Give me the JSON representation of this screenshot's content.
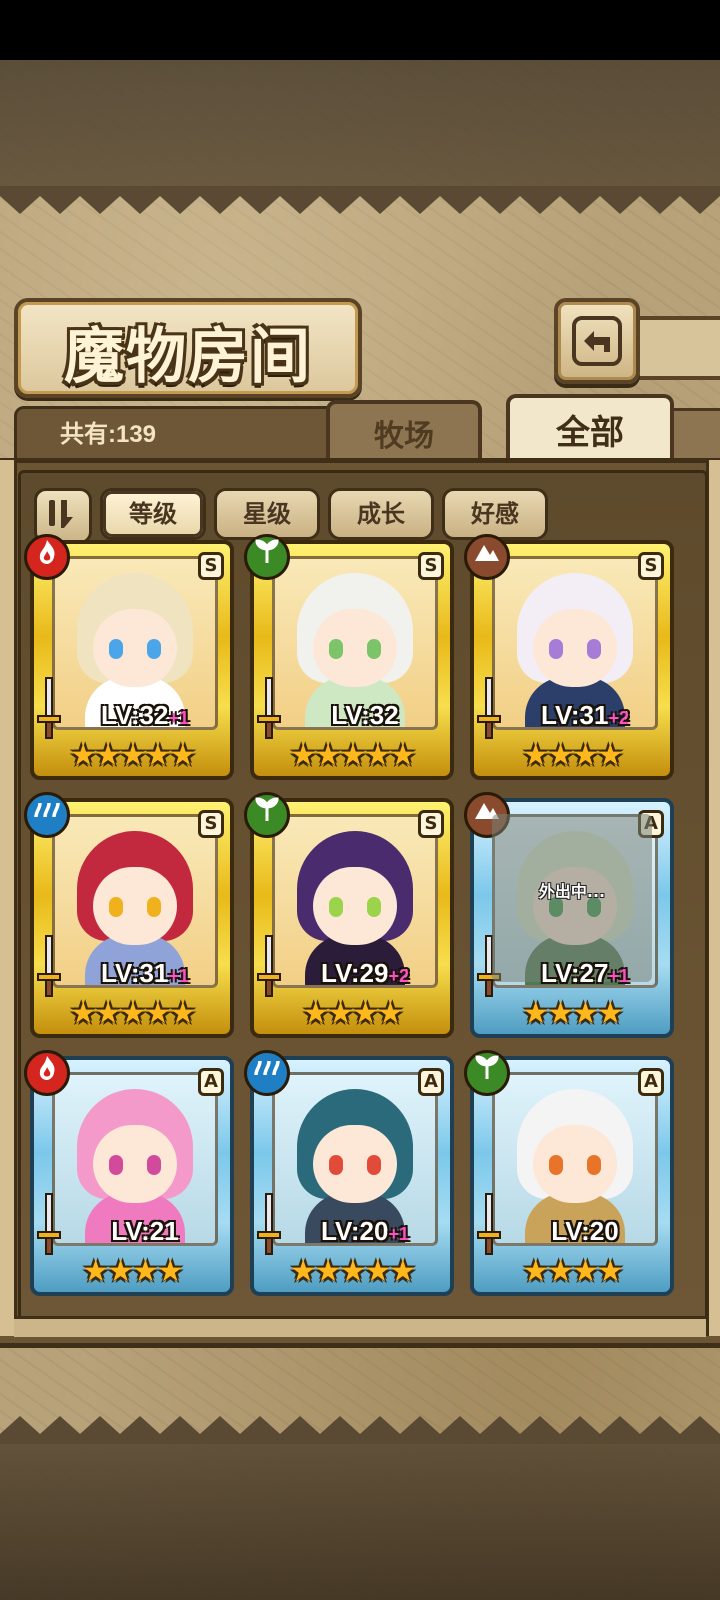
{
  "header": {
    "title": "魔物房间"
  },
  "tabs": {
    "count_label": "共有:139",
    "ranch": "牧场",
    "all": "全部"
  },
  "sort": {
    "buttons": [
      "等级",
      "星级",
      "成长",
      "好感"
    ],
    "active": "等级"
  },
  "cards": [
    {
      "element": "fire",
      "rank": "S",
      "frame": "gold",
      "level": "LV:32",
      "bonus": "+1",
      "stars": "★★★★★",
      "hair": "#efe3c0",
      "eye": "#4aa6e8",
      "outfit": "#ffffff"
    },
    {
      "element": "leaf",
      "rank": "S",
      "frame": "gold",
      "level": "LV:32",
      "bonus": "",
      "stars": "★★★★★",
      "hair": "#f1f1ee",
      "eye": "#7cc46a",
      "outfit": "#cfe8c4"
    },
    {
      "element": "earth",
      "rank": "S",
      "frame": "gold",
      "level": "LV:31",
      "bonus": "+2",
      "stars": "★★★★",
      "hair": "#f3eef6",
      "eye": "#a57cd6",
      "outfit": "#2c3f6a"
    },
    {
      "element": "water",
      "rank": "S",
      "frame": "gold",
      "level": "LV:31",
      "bonus": "+1",
      "stars": "★★★★★",
      "hair": "#c2283e",
      "eye": "#f0b21c",
      "outfit": "#8fa3d8"
    },
    {
      "element": "leaf",
      "rank": "S",
      "frame": "gold",
      "level": "LV:29",
      "bonus": "+2",
      "stars": "★★★★",
      "hair": "#4a2c6e",
      "eye": "#9bd34a",
      "outfit": "#2b1c3a"
    },
    {
      "element": "earth",
      "rank": "A",
      "frame": "blue",
      "level": "LV:27",
      "bonus": "+1",
      "stars": "★★★★",
      "hair": "#d8e6cc",
      "eye": "#3a9a4a",
      "outfit": "#4c7a52",
      "status": "外出中..."
    },
    {
      "element": "fire",
      "rank": "A",
      "frame": "blue",
      "level": "LV:21",
      "bonus": "",
      "stars": "★★★★",
      "hair": "#f49acb",
      "eye": "#d24a9c",
      "outfit": "#f07ac0"
    },
    {
      "element": "water",
      "rank": "A",
      "frame": "blue",
      "level": "LV:20",
      "bonus": "+1",
      "stars": "★★★★★",
      "hair": "#2a6a7a",
      "eye": "#e24a3a",
      "outfit": "#3a4a5e"
    },
    {
      "element": "leaf",
      "rank": "A",
      "frame": "blue",
      "level": "LV:20",
      "bonus": "",
      "stars": "★★★★",
      "hair": "#f4f4f4",
      "eye": "#e8742a",
      "outfit": "#c9a35a"
    }
  ],
  "colors": {
    "panel": "#6b5533",
    "gold_frame": "#e8b919",
    "blue_frame": "#7cc8ea",
    "bonus": "#ff4fc6"
  },
  "icons": {
    "back": "back-arrow-icon",
    "sort_toggle": "sort-order-icon",
    "fire": "fire-element-icon",
    "leaf": "leaf-element-icon",
    "earth": "earth-element-icon",
    "water": "water-element-icon",
    "sword": "sword-icon",
    "star": "star-icon"
  }
}
